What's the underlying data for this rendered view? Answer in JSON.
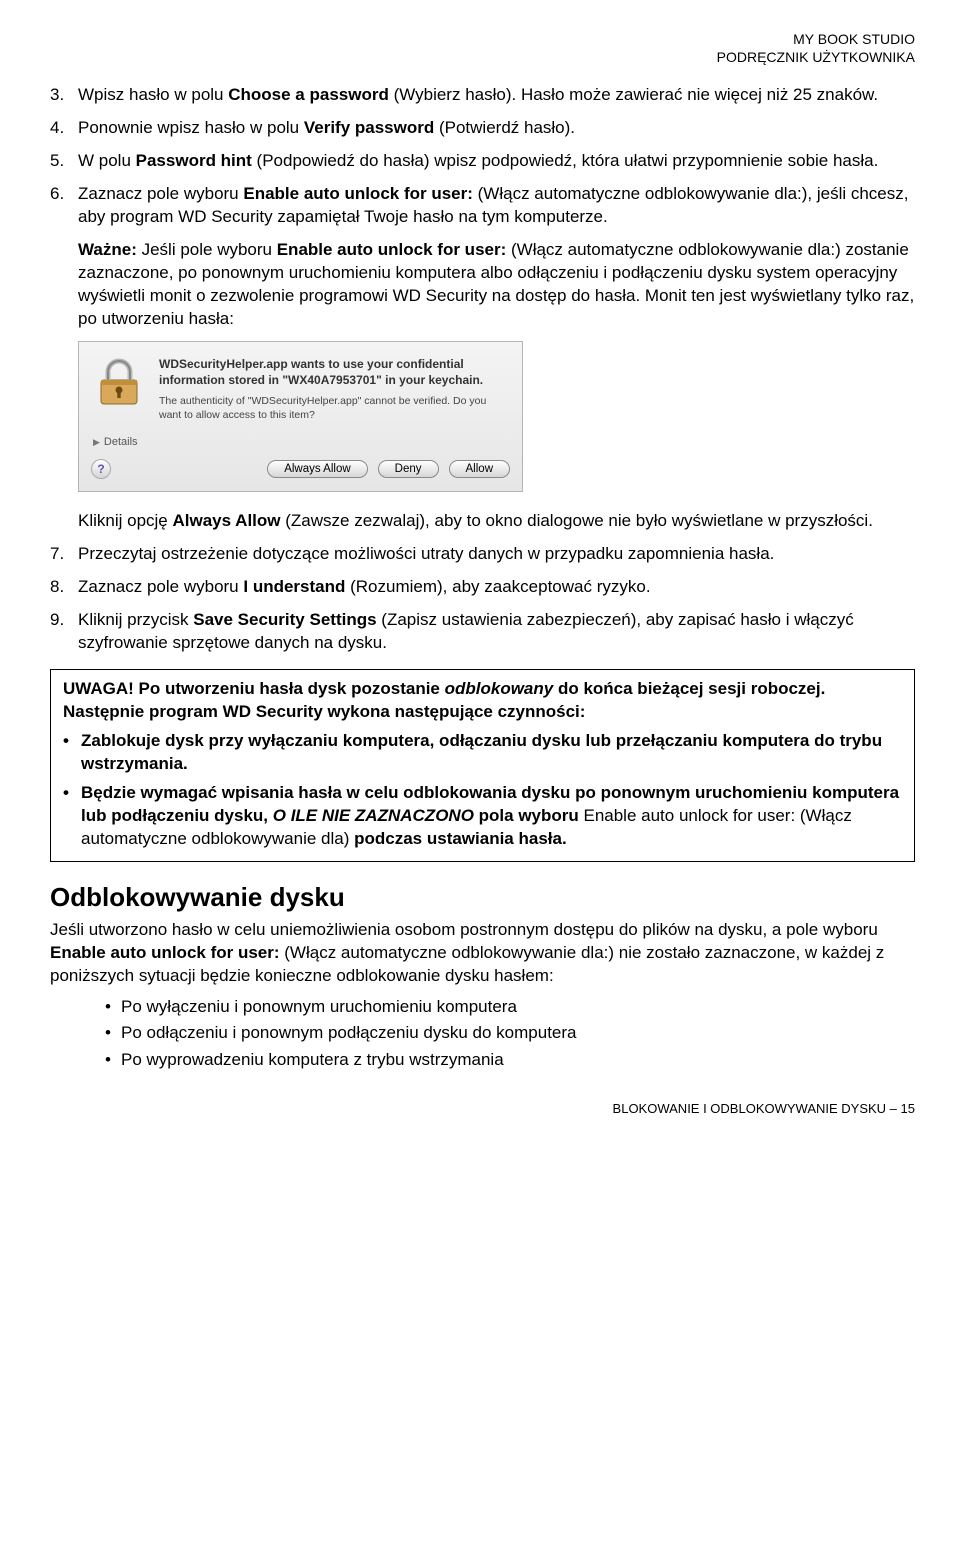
{
  "header": {
    "line1": "MY BOOK STUDIO",
    "line2": "PODRĘCZNIK UŻYTKOWNIKA"
  },
  "steps": {
    "s3": {
      "num": "3.",
      "a": "Wpisz hasło w polu ",
      "b": "Choose a password",
      "c": " (Wybierz hasło). Hasło może zawierać nie więcej niż 25 znaków."
    },
    "s4": {
      "num": "4.",
      "a": "Ponownie wpisz hasło w polu ",
      "b": "Verify password",
      "c": " (Potwierdź hasło)."
    },
    "s5": {
      "num": "5.",
      "a": "W polu ",
      "b": "Password hint",
      "c": " (Podpowiedź do hasła) wpisz podpowiedź, która ułatwi przypomnienie sobie hasła."
    },
    "s6": {
      "num": "6.",
      "a": "Zaznacz pole wyboru ",
      "b": "Enable auto unlock for user:",
      "c": " (Włącz automatyczne odblokowywanie dla:), jeśli chcesz, aby program WD Security zapamiętał Twoje hasło na tym komputerze."
    },
    "important": {
      "a": "Ważne:",
      "b": " Jeśli pole wyboru ",
      "c": "Enable auto unlock for user:",
      "d": " (Włącz automatyczne odblokowywanie dla:) zostanie zaznaczone, po ponownym uruchomieniu komputera albo odłączeniu i podłączeniu dysku system operacyjny wyświetli monit o zezwolenie programowi WD Security na dostęp do hasła. Monit ten jest wyświetlany tylko raz, po utworzeniu hasła:"
    },
    "after_dialog": {
      "a": "Kliknij opcję ",
      "b": "Always Allow",
      "c": " (Zawsze zezwalaj), aby to okno dialogowe nie było wyświetlane w przyszłości."
    },
    "s7": {
      "num": "7.",
      "text": "Przeczytaj ostrzeżenie dotyczące możliwości utraty danych w przypadku zapomnienia hasła."
    },
    "s8": {
      "num": "8.",
      "a": "Zaznacz pole wyboru ",
      "b": "I understand",
      "c": " (Rozumiem), aby zaakceptować ryzyko."
    },
    "s9": {
      "num": "9.",
      "a": "Kliknij przycisk ",
      "b": "Save Security Settings",
      "c": " (Zapisz ustawienia zabezpieczeń), aby zapisać hasło i włączyć szyfrowanie sprzętowe danych na dysku."
    }
  },
  "dialog": {
    "line1": "WDSecurityHelper.app wants to use your confidential information stored in \"WX40A7953701\" in your keychain.",
    "line2": "The authenticity of \"WDSecurityHelper.app\" cannot be verified. Do you want to allow access to this item?",
    "details": "Details",
    "help": "?",
    "btn_always": "Always Allow",
    "btn_deny": "Deny",
    "btn_allow": "Allow"
  },
  "infobox": {
    "head_a": "UWAGA! Po utworzeniu hasła dysk pozostanie ",
    "head_b": "odblokowany",
    "head_c": " do końca bieżącej sesji roboczej. Następnie program WD Security wykona następujące czynności:",
    "b1": "Zablokuje dysk przy wyłączaniu komputera, odłączaniu dysku lub przełączaniu komputera do trybu wstrzymania.",
    "b2_a": "Będzie wymagać wpisania hasła w celu odblokowania dysku po ponownym uruchomieniu komputera lub podłączeniu dysku, ",
    "b2_b": "O ILE NIE ZAZNACZONO",
    "b2_c": " pola wyboru ",
    "b2_d": "Enable auto unlock for user: (Włącz automatyczne odblokowywanie dla) ",
    "b2_e": "podczas ustawiania hasła."
  },
  "section2": {
    "title": "Odblokowywanie dysku",
    "intro_a": "Jeśli utworzono hasło w celu uniemożliwienia osobom postronnym dostępu do plików na dysku, a pole wyboru ",
    "intro_b": "Enable auto unlock for user:",
    "intro_c": " (Włącz automatyczne odblokowywanie dla:) nie zostało zaznaczone, w każdej z poniższych sytuacji będzie konieczne odblokowanie dysku hasłem:",
    "li1": "Po wyłączeniu i ponownym uruchomieniu komputera",
    "li2": "Po odłączeniu i ponownym podłączeniu dysku do komputera",
    "li3": "Po wyprowadzeniu komputera z trybu wstrzymania"
  },
  "footer": "BLOKOWANIE I ODBLOKOWYWANIE DYSKU – 15"
}
